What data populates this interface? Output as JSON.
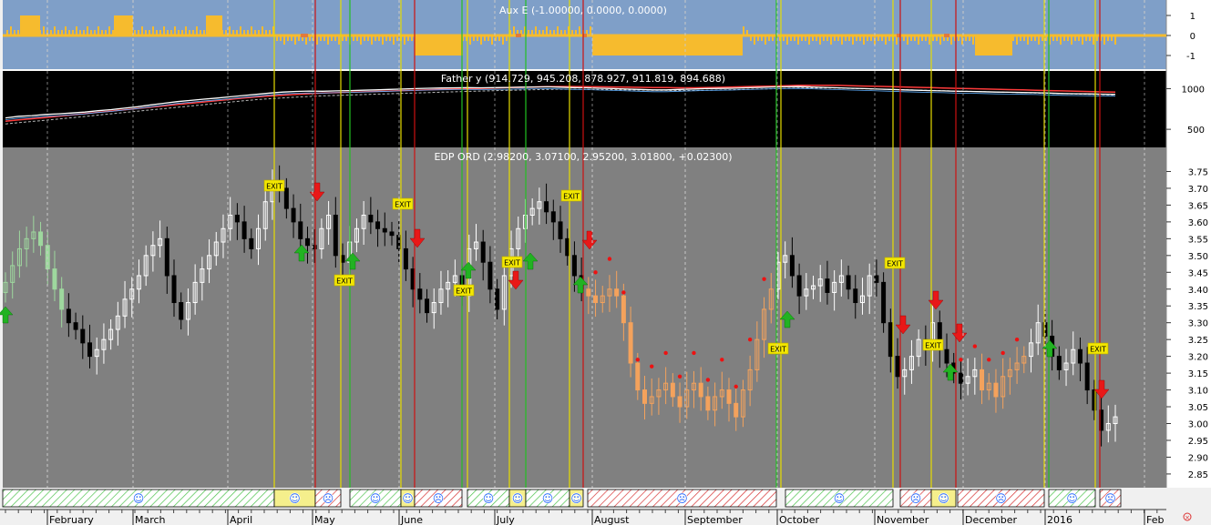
{
  "panels": {
    "aux": {
      "title": "Aux E (-1.00000, 0.0000, 0.0000)",
      "ticks": [
        "1",
        "0",
        "-1"
      ],
      "color_bg": "#7f9fc8",
      "color_bar": "#f6bb2e",
      "color_marker": "#e07a3c"
    },
    "father": {
      "title": "Father y (914.729, 945.208, 878.927, 911.819, 894.688)",
      "ticks": [
        "1000",
        "500"
      ],
      "color_bg": "#000000",
      "color_line": "#ffffff",
      "color_ma_red": "#ff3b3b",
      "color_ma_dash": "#b8b8b8"
    },
    "main": {
      "title": "EDP ORD (2.98200, 3.07100, 2.95200, 3.01800, +0.02300)",
      "ticks": [
        "3.75",
        "3.70",
        "3.65",
        "3.60",
        "3.55",
        "3.50",
        "3.45",
        "3.40",
        "3.35",
        "3.30",
        "3.25",
        "3.20",
        "3.15",
        "3.10",
        "3.05",
        "3.00",
        "2.95",
        "2.90",
        "2.85"
      ],
      "color_bg": "#808080",
      "color_up": "#ffffff",
      "color_down": "#000000",
      "color_orange": "#f4a25c",
      "color_green": "#9ed89e"
    }
  },
  "signals": {
    "exit_label": "EXIT",
    "color_exit_bg": "#f3e700",
    "color_arrow_down": "#e81818",
    "color_arrow_up": "#22b222",
    "color_dot": "#ee1111",
    "color_vline_yellow": "#e6dc00",
    "color_vline_green": "#22c022",
    "color_vline_red": "#cc1111"
  },
  "regime_strip": {
    "smile_glyph": "☺",
    "frown_glyph": "☹",
    "color_green_hatch": "#4cc24c",
    "color_red_hatch": "#d63232",
    "color_yellow_fill": "#f5ef8c",
    "color_face_blue": "#2266ff"
  },
  "time_axis": {
    "months": [
      "February",
      "March",
      "April",
      "May",
      "June",
      "July",
      "August",
      "September",
      "October",
      "November",
      "December",
      "2016",
      "Feb"
    ]
  },
  "chart_data": [
    {
      "type": "bar",
      "title": "Aux E (-1.00000, 0.0000, 0.0000)",
      "ylim": [
        -1.5,
        1.5
      ],
      "tick_labels": [
        "1",
        "0",
        "-1"
      ],
      "note_values": [
        -1,
        0,
        1
      ]
    },
    {
      "type": "line",
      "title": "Father y (914.729, 945.208, 878.927, 911.819, 894.688)",
      "ylim": [
        300,
        1150
      ],
      "tick_labels": [
        "1000",
        "500"
      ],
      "series": [
        {
          "values": [
            640,
            660,
            668,
            682,
            690,
            700,
            712,
            728,
            742,
            760,
            778,
            800,
            820,
            840,
            855,
            870,
            884,
            900,
            915,
            930,
            945,
            958,
            965,
            970,
            968,
            972,
            975,
            980,
            985,
            990,
            995,
            1000,
            1005,
            1008,
            1010,
            1012,
            1010,
            1012,
            1015,
            1018,
            1020,
            1022,
            1018,
            1012,
            1010,
            1005,
            1000,
            995,
            990,
            985,
            985,
            990,
            995,
            1000,
            1002,
            1005,
            1010,
            1015,
            1020,
            1022,
            1025,
            1020,
            1015,
            1010,
            1005,
            1000,
            995,
            990,
            985,
            980,
            975,
            972,
            968,
            965,
            962,
            958,
            955,
            952,
            950,
            945,
            940,
            938,
            935,
            932,
            930
          ]
        },
        {
          "values": [
            600,
            615,
            630,
            645,
            660,
            676,
            692,
            708,
            724,
            740,
            756,
            772,
            788,
            804,
            820,
            836,
            852,
            868,
            884,
            898,
            910,
            920,
            930,
            938,
            945,
            950,
            955,
            960,
            965,
            970,
            975,
            980,
            985,
            990,
            995,
            1000,
            1004,
            1008,
            1012,
            1016,
            1020,
            1024,
            1026,
            1026,
            1024,
            1022,
            1020,
            1018,
            1016,
            1014,
            1012,
            1010,
            1010,
            1012,
            1016,
            1020,
            1024,
            1028,
            1032,
            1036,
            1040,
            1042,
            1042,
            1040,
            1036,
            1032,
            1028,
            1024,
            1020,
            1016,
            1012,
            1008,
            1004,
            1000,
            996,
            992,
            988,
            984,
            980,
            976,
            972,
            968,
            964,
            960,
            956
          ]
        }
      ]
    },
    {
      "type": "candlestick",
      "title": "EDP ORD (2.98200, 3.07100, 2.95200, 3.01800, +0.02300)",
      "ylim": [
        2.82,
        3.8
      ],
      "ylabel_ticks": [
        "3.75",
        "3.70",
        "3.65",
        "3.60",
        "3.55",
        "3.50",
        "3.45",
        "3.40",
        "3.35",
        "3.30",
        "3.25",
        "3.20",
        "3.15",
        "3.10",
        "3.05",
        "3.00",
        "2.95",
        "2.90",
        "2.85"
      ],
      "x": [
        "February",
        "March",
        "April",
        "May",
        "June",
        "July",
        "August",
        "September",
        "October",
        "November",
        "December",
        "2016",
        "Feb"
      ],
      "closes": [
        3.42,
        3.47,
        3.52,
        3.55,
        3.57,
        3.53,
        3.46,
        3.4,
        3.34,
        3.3,
        3.28,
        3.24,
        3.2,
        3.22,
        3.25,
        3.28,
        3.32,
        3.37,
        3.4,
        3.44,
        3.5,
        3.53,
        3.55,
        3.44,
        3.36,
        3.31,
        3.36,
        3.42,
        3.46,
        3.5,
        3.54,
        3.58,
        3.62,
        3.6,
        3.55,
        3.52,
        3.58,
        3.66,
        3.72,
        3.7,
        3.64,
        3.6,
        3.55,
        3.53,
        3.52,
        3.58,
        3.62,
        3.5,
        3.48,
        3.54,
        3.58,
        3.62,
        3.6,
        3.58,
        3.57,
        3.56,
        3.52,
        3.46,
        3.4,
        3.37,
        3.33,
        3.36,
        3.4,
        3.42,
        3.44,
        3.38,
        3.52,
        3.54,
        3.48,
        3.4,
        3.34,
        3.44,
        3.52,
        3.58,
        3.62,
        3.64,
        3.66,
        3.63,
        3.6,
        3.55,
        3.5,
        3.44,
        3.4,
        3.38,
        3.36,
        3.38,
        3.4,
        3.38,
        3.3,
        3.18,
        3.1,
        3.06,
        3.08,
        3.1,
        3.12,
        3.08,
        3.05,
        3.1,
        3.12,
        3.08,
        3.04,
        3.08,
        3.1,
        3.06,
        3.02,
        3.1,
        3.16,
        3.25,
        3.34,
        3.4,
        3.48,
        3.5,
        3.44,
        3.38,
        3.4,
        3.41,
        3.43,
        3.39,
        3.42,
        3.44,
        3.4,
        3.36,
        3.38,
        3.44,
        3.42,
        3.3,
        3.2,
        3.14,
        3.16,
        3.2,
        3.25,
        3.22,
        3.3,
        3.22,
        3.18,
        3.15,
        3.12,
        3.14,
        3.16,
        3.1,
        3.12,
        3.08,
        3.14,
        3.16,
        3.18,
        3.2,
        3.24,
        3.3,
        3.26,
        3.2,
        3.16,
        3.18,
        3.22,
        3.18,
        3.1,
        3.04,
        2.98,
        3.0,
        3.02
      ]
    }
  ]
}
